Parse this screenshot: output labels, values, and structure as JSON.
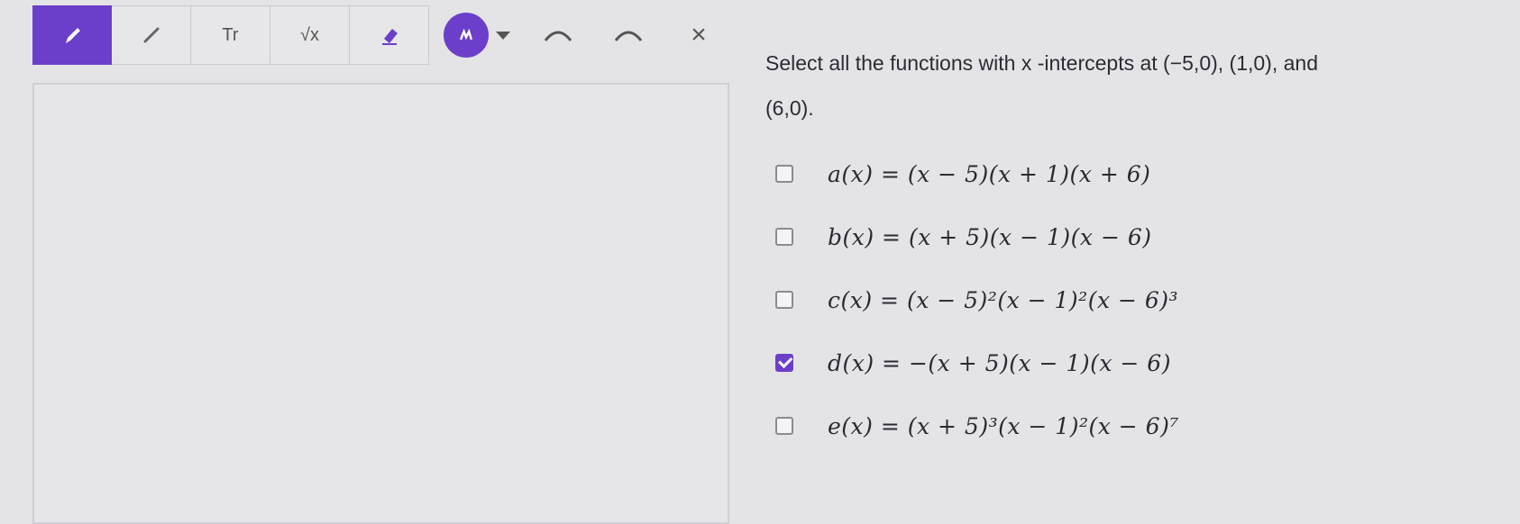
{
  "toolbar": {
    "tools": [
      {
        "name": "pencil-tool",
        "icon": "pencil-icon",
        "active": true
      },
      {
        "name": "line-tool",
        "icon": "line-icon",
        "active": false
      },
      {
        "name": "text-tool",
        "icon": "text-icon",
        "label": "Tr",
        "active": false
      },
      {
        "name": "math-tool",
        "icon": "sqrt-icon",
        "label": "√x",
        "active": false
      },
      {
        "name": "eraser-tool",
        "icon": "eraser-icon",
        "active": false
      }
    ],
    "accent_color": "#6b3fc9",
    "undo_icon": "undo-icon",
    "redo_icon": "redo-icon",
    "clear_label": "×"
  },
  "question": {
    "prompt": "Select all the functions with x -intercepts at (−5,0), (1,0), and",
    "prompt_cont": "(6,0)."
  },
  "options": [
    {
      "id": "a",
      "text": "a(x) = (x − 5)(x + 1)(x + 6)",
      "checked": false
    },
    {
      "id": "b",
      "text": "b(x) = (x + 5)(x − 1)(x − 6)",
      "checked": false
    },
    {
      "id": "c",
      "text": "c(x) = (x − 5)²(x − 1)²(x − 6)³",
      "checked": false
    },
    {
      "id": "d",
      "text": "d(x) = −(x + 5)(x − 1)(x − 6)",
      "checked": true
    },
    {
      "id": "e",
      "text": "e(x) = (x + 5)³(x − 1)²(x − 6)⁷",
      "checked": false
    }
  ]
}
